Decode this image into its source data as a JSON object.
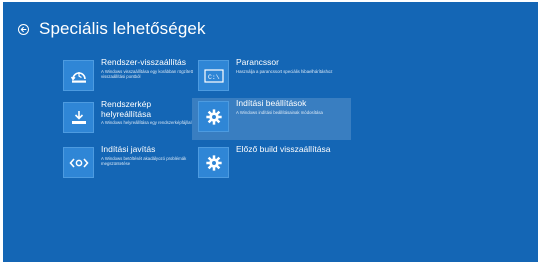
{
  "header": {
    "title": "Speciális lehetőségek"
  },
  "tiles": [
    {
      "title": "Rendszer-visszaállítás",
      "desc": "A Windows visszaállítása egy korábban rögzített visszaállítási pontból",
      "icon": "system-restore-icon"
    },
    {
      "title": "Parancssor",
      "desc": "Használja a parancssort speciális hibaelhárításhoz",
      "icon": "command-prompt-icon"
    },
    {
      "title": "Rendszerkép helyreállítása",
      "desc": "A Windows helyreállítása egy rendszerképfájllal",
      "icon": "image-recovery-icon"
    },
    {
      "title": "Indítási beállítások",
      "desc": "A Windows indítási beállításainak módosítása",
      "icon": "gear-icon"
    },
    {
      "title": "Indítási javítás",
      "desc": "A Windows betöltését akadályozó problémák megszüntetése",
      "icon": "startup-repair-icon"
    },
    {
      "title": "Előző build visszaállítása",
      "desc": "",
      "icon": "gear-icon"
    }
  ],
  "colors": {
    "background": "#1466b5",
    "tile_icon": "#2f86d6",
    "text": "#ffffff"
  }
}
